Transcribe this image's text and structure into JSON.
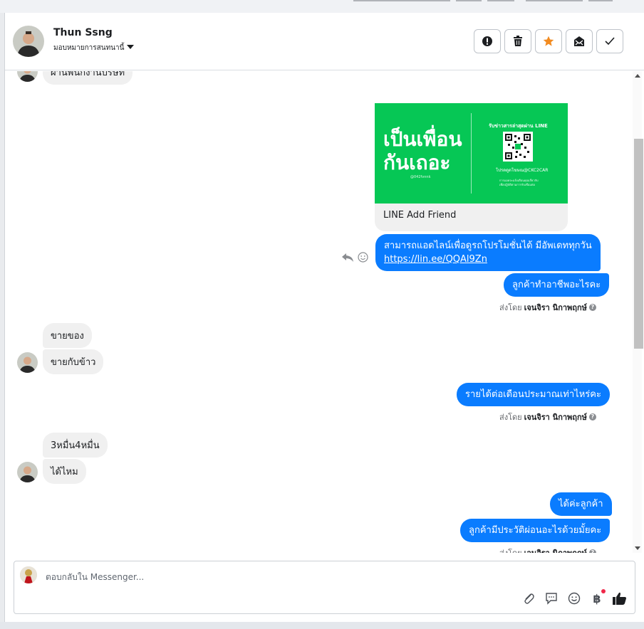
{
  "header": {
    "name": "Thun Ssng",
    "assign_label": "มอบหมายการสนทนานี้",
    "buttons": [
      {
        "icon": "alert-icon",
        "label": "Mark as spam"
      },
      {
        "icon": "trash-icon",
        "label": "Delete"
      },
      {
        "icon": "star-icon",
        "label": "Star"
      },
      {
        "icon": "mark-unread-icon",
        "label": "Mark as unread"
      },
      {
        "icon": "check-icon",
        "label": "Mark as done"
      }
    ]
  },
  "messages": {
    "partial_top": "ผ่านพนักงานบริษัท",
    "card": {
      "headline1": "เป็นเพื่อน",
      "headline2": "กันเถอะ",
      "line_id": "@042fvnnk",
      "qr_title": "รับข่าวสารล่าสุดผ่าน LINE",
      "qr_id": "โปรดดูดโฆษณ@CKC2CAR",
      "qr_note1": "การแอดจะแจ้งเตือนคุณเกี่ยวกับ",
      "qr_note2": "เพื่อปฏิบัติตามการรับเชื่อมต่อ",
      "caption": "LINE Add Friend"
    },
    "out1_line1": "สามารถแอดไลน์เพื่อดูรถโปรโมชั่นได้ มีอัพเดททุกวัน",
    "out1_link": "https://lin.ee/QQAl9Zn",
    "out2": "ลูกค้าทำอาชีพอะไรคะ",
    "sent1_prefix": "ส่งโดย",
    "sent1_name": "เจนจิรา นิกาพฤกษ์",
    "in1": "ขายของ",
    "in2": "ขายกับข้าว",
    "out3": "รายได้ต่อเดือนประมาณเท่าไหร่คะ",
    "sent2_prefix": "ส่งโดย",
    "sent2_name": "เจนจิรา นิกาพฤกษ์",
    "in3": "3หมื่น4หมื่น",
    "in4": "ได้ไหม",
    "out4": "ได้ค่ะลูกค้า",
    "out5": "ลูกค้ามีประวัติผ่อนอะไรด้วยมั้ยคะ",
    "sent3_prefix": "ส่งโดย",
    "sent3_name": "เจนจิรา นิกาพฤกษ์",
    "help_glyph": "?"
  },
  "composer": {
    "placeholder": "ตอบกลับใน Messenger...",
    "tools": [
      "attachment-icon",
      "saved-reply-icon",
      "emoji-icon",
      "payment-icon",
      "like-icon"
    ],
    "payment_glyph": "฿"
  },
  "colors": {
    "outgoing": "#0a7cff",
    "incoming": "#f0f0f0",
    "line_green": "#06c755",
    "star": "#f28b20"
  }
}
